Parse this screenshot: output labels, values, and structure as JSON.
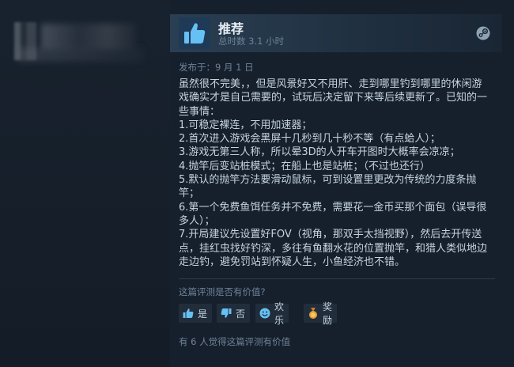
{
  "review": {
    "verdict": "推荐",
    "playtime": "总时数 3.1 小时",
    "posted": "发布于：9 月 1 日",
    "body_lines": [
      "虽然很不完美，，但是风景好又不用肝、走到哪里钓到哪里的休闲游",
      "戏确实才是自己需要的，试玩后决定留下来等后续更新了。已知的一",
      "些事情：",
      "1.可稳定裸连，不用加速器；",
      "2.首次进入游戏会黑屏十几秒到几十秒不等（有点蛤人）；",
      "3.游戏无第三人称，所以晕3D的人开车开图时大概率会凉凉；",
      "4.抛竿后变站桩模式；在船上也是站桩；（不过也还行）",
      "5.默认的抛竿方法要滑动鼠标，可到设置里更改为传统的力度条抛",
      "竿；",
      "6.第一个免费鱼饵任务并不免费，需要花一金币买那个面包（误导很",
      "多人）；",
      "7.开局建议先设置好FOV（视角，那双手太挡视野），然后去开传送",
      "点，挂红虫找好钓深，多往有鱼翻水花的位置抛竿，和猎人类似地边",
      "走边钓，避免罚站到怀疑人生，小鱼经济也不错。"
    ]
  },
  "feedback": {
    "question": "这篇评测是否有价值?",
    "yes_label": "是",
    "no_label": "否",
    "funny_label": "欢乐",
    "award_label": "奖励",
    "helpful_count": "有 6 人觉得这篇评测有价值"
  },
  "icons": {
    "verdict": "thumbs-up-icon",
    "platform": "steam-icon"
  },
  "colors": {
    "background": "#1b2838",
    "card": "#16202d",
    "verdict_box": "#1f3a56",
    "thumb_blue": "#66c0f4",
    "award_gold": "#e8a33a"
  }
}
